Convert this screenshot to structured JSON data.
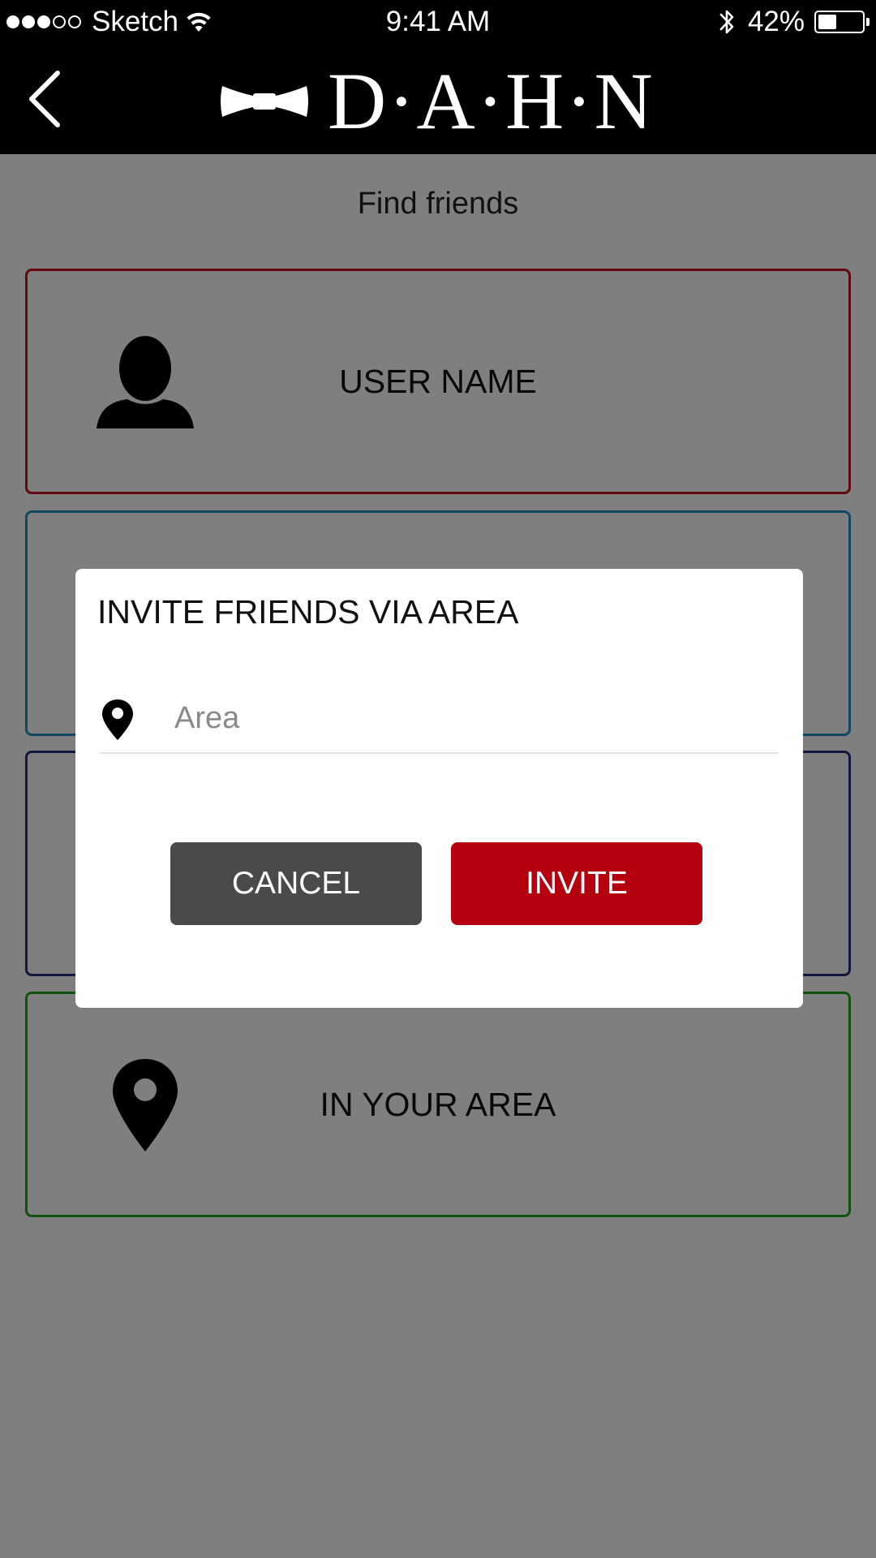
{
  "status_bar": {
    "carrier": "Sketch",
    "time": "9:41 AM",
    "battery_percent": "42%",
    "battery_level": 0.42,
    "signal_bars_filled": 3,
    "signal_bars_total": 5
  },
  "nav": {
    "back_icon": "chevron-left-icon",
    "brand_icon": "bow-tie-icon",
    "brand_name": "D·A·H·N"
  },
  "page": {
    "title": "Find friends"
  },
  "options": [
    {
      "label": "USER NAME",
      "icon": "user-icon",
      "color": "#c8101e"
    },
    {
      "label": "",
      "icon": "",
      "color": "#1e8fc8"
    },
    {
      "label": "",
      "icon": "",
      "color": "#26307e"
    },
    {
      "label": "IN YOUR AREA",
      "icon": "location-pin-icon",
      "color": "#1fa61f"
    }
  ],
  "dialog": {
    "title": "INVITE FRIENDS VIA AREA",
    "area_field": {
      "icon": "location-pin-icon",
      "placeholder": "Area",
      "value": ""
    },
    "cancel_label": "CANCEL",
    "invite_label": "INVITE",
    "colors": {
      "cancel": "#4a4a4a",
      "invite": "#b5000f"
    }
  }
}
